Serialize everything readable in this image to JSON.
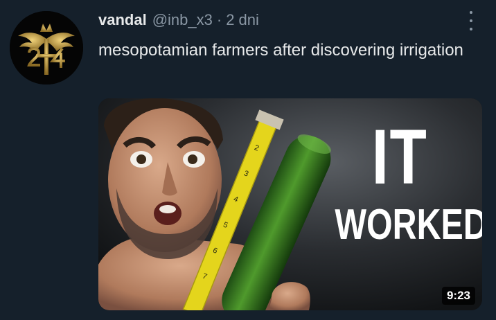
{
  "tweet": {
    "display_name": "vandal",
    "handle": "@inb_x3",
    "separator": "·",
    "time": "2 dni",
    "text": "mesopotamian farmers after discovering irrigation"
  },
  "media": {
    "headline_line1": "IT",
    "headline_line2": "WORKED!",
    "duration": "9:23"
  },
  "colors": {
    "background": "#15202b",
    "text_primary": "#e7e9ea",
    "text_secondary": "#8b98a5",
    "avatar_gold": "#c9a24a"
  },
  "icons": {
    "more": "more-options-icon",
    "avatar": "winged-emblem-avatar"
  }
}
